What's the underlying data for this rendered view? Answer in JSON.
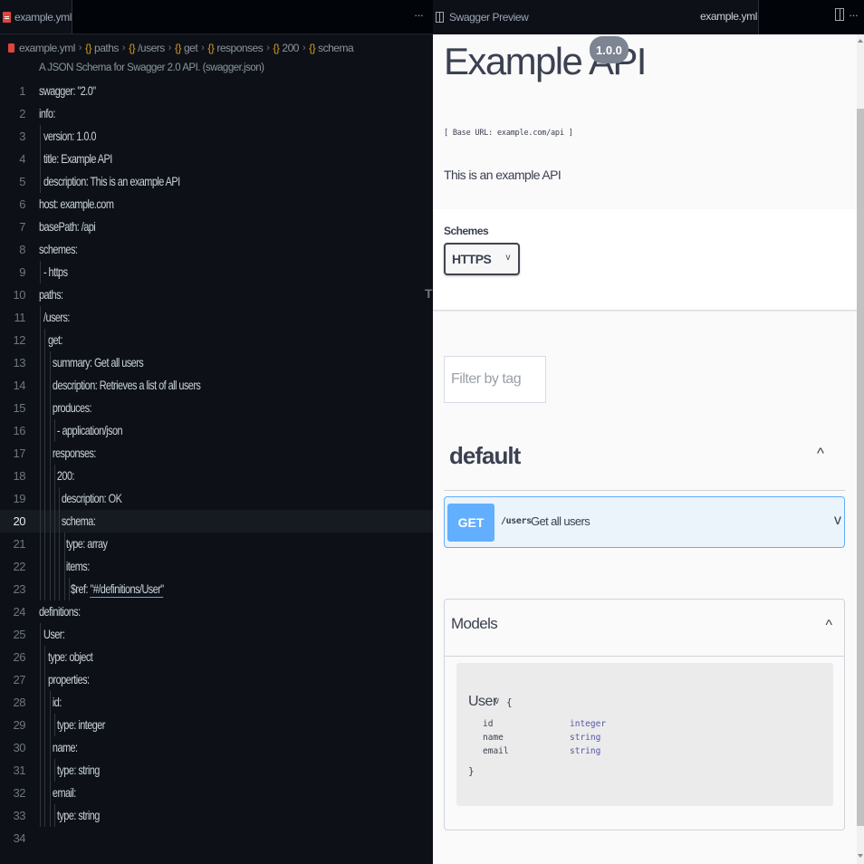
{
  "editor": {
    "tab_label": "example.yml",
    "tab_more": "···",
    "breadcrumb": {
      "file": "example.yml",
      "segments": [
        "paths",
        "/users",
        "get",
        "responses",
        "200",
        "schema"
      ]
    },
    "schema_hint": "A JSON Schema for Swagger 2.0 API. (swagger.json)",
    "current_line": 20,
    "lines": [
      {
        "n": "1",
        "text": "swagger: \"2.0\""
      },
      {
        "n": "2",
        "text": "info:"
      },
      {
        "n": "3",
        "text": "  version: 1.0.0"
      },
      {
        "n": "4",
        "text": "  title: Example API"
      },
      {
        "n": "5",
        "text": "  description: This is an example API"
      },
      {
        "n": "6",
        "text": "host: example.com"
      },
      {
        "n": "7",
        "text": "basePath: /api"
      },
      {
        "n": "8",
        "text": "schemes:"
      },
      {
        "n": "9",
        "text": "  - https"
      },
      {
        "n": "10",
        "text": "paths:"
      },
      {
        "n": "11",
        "text": "  /users:"
      },
      {
        "n": "12",
        "text": "    get:"
      },
      {
        "n": "13",
        "text": "      summary: Get all users"
      },
      {
        "n": "14",
        "text": "      description: Retrieves a list of all users"
      },
      {
        "n": "15",
        "text": "      produces:"
      },
      {
        "n": "16",
        "text": "        - application/json"
      },
      {
        "n": "17",
        "text": "      responses:"
      },
      {
        "n": "18",
        "text": "        200:"
      },
      {
        "n": "19",
        "text": "          description: OK"
      },
      {
        "n": "20",
        "text": "          schema:"
      },
      {
        "n": "21",
        "text": "            type: array"
      },
      {
        "n": "22",
        "text": "            items:"
      },
      {
        "n": "23",
        "text": "              $ref: \"#/definitions/User\""
      },
      {
        "n": "24",
        "text": "definitions:"
      },
      {
        "n": "25",
        "text": "  User:"
      },
      {
        "n": "26",
        "text": "    type: object"
      },
      {
        "n": "27",
        "text": "    properties:"
      },
      {
        "n": "28",
        "text": "      id:"
      },
      {
        "n": "29",
        "text": "        type: integer"
      },
      {
        "n": "30",
        "text": "      name:"
      },
      {
        "n": "31",
        "text": "        type: string"
      },
      {
        "n": "32",
        "text": "      email:"
      },
      {
        "n": "33",
        "text": "        type: string"
      },
      {
        "n": "34",
        "text": ""
      }
    ],
    "stray_glyph": "T"
  },
  "preview": {
    "tab_label": "Swagger Preview",
    "tab_file": "example.yml",
    "more": "···",
    "info": {
      "title": "Example API",
      "version": "1.0.0",
      "base_url": "[ Base URL: example.com/api ]",
      "description": "This is an example API"
    },
    "schemes": {
      "label": "Schemes",
      "selected": "HTTPS",
      "chevron": "v"
    },
    "filter": {
      "placeholder": "Filter by tag"
    },
    "tag": {
      "name": "default",
      "toggle": "^"
    },
    "operation": {
      "method": "GET",
      "path": "/users",
      "summary": "Get all users",
      "toggle": "v"
    },
    "models": {
      "title": "Models",
      "toggle": "^",
      "model_name": "User",
      "chevron": "v",
      "brace_open": "{",
      "brace_close": "}",
      "properties": [
        {
          "name": "id",
          "type": "integer"
        },
        {
          "name": "name",
          "type": "string"
        },
        {
          "name": "email",
          "type": "string"
        }
      ]
    }
  },
  "colors": {
    "editor_bg": "#0d1117",
    "method_get": "#61affe",
    "version_badge": "#7d8492",
    "brace_accent": "#d29922"
  }
}
